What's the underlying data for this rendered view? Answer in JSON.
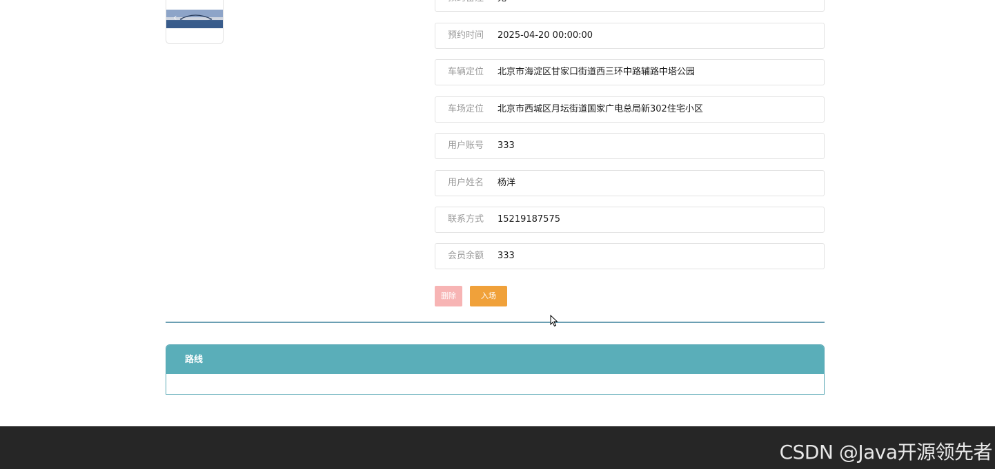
{
  "thumbnail": {
    "prev_arrow": "‹"
  },
  "fields": [
    {
      "label": "预约备注",
      "value": "无"
    },
    {
      "label": "预约时间",
      "value": "2025-04-20 00:00:00"
    },
    {
      "label": "车辆定位",
      "value": "北京市海淀区甘家口街道西三环中路辅路中塔公园"
    },
    {
      "label": "车场定位",
      "value": "北京市西城区月坛街道国家广电总局新302住宅小区"
    },
    {
      "label": "用户账号",
      "value": "333"
    },
    {
      "label": "用户姓名",
      "value": "杨洋"
    },
    {
      "label": "联系方式",
      "value": "15219187575"
    },
    {
      "label": "会员余额",
      "value": "333"
    }
  ],
  "actions": {
    "delete_label": "删除",
    "enter_label": "入场"
  },
  "route_panel": {
    "title": "路线"
  },
  "watermark": "CSDN @Java开源领先者",
  "colors": {
    "delete_button": "#f7b4b4",
    "enter_button": "#f0a13a",
    "panel_header": "#5aaeb9",
    "divider": "#6b9fb3",
    "footer": "#262626"
  }
}
